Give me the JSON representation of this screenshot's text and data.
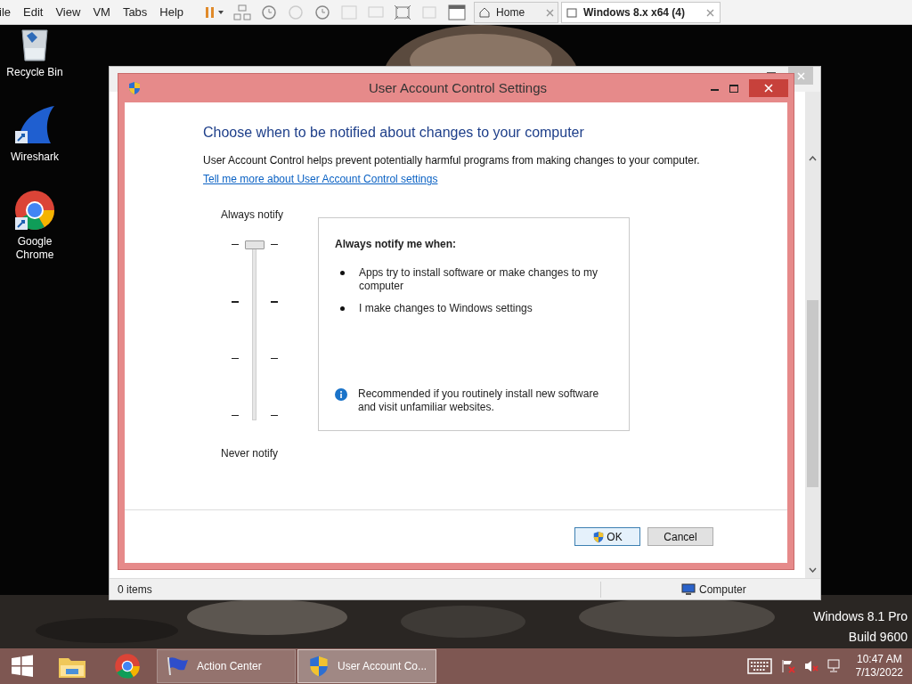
{
  "vm_menu": [
    "ile",
    "Edit",
    "View",
    "VM",
    "Tabs",
    "Help"
  ],
  "vm_tabs": [
    {
      "label": "Home",
      "selected": false
    },
    {
      "label": "Windows 8.x x64 (4)",
      "selected": true
    }
  ],
  "desktop_icons": [
    {
      "label": "Recycle Bin",
      "kind": "recycle"
    },
    {
      "label": "Wireshark",
      "kind": "wireshark"
    },
    {
      "label": "Google Chrome",
      "kind": "chrome"
    }
  ],
  "explorer": {
    "status": "0 items",
    "location": "Computer"
  },
  "dialog": {
    "title": "User Account Control Settings",
    "heading": "Choose when to be notified about changes to your computer",
    "description": "User Account Control helps prevent potentially harmful programs from making changes to your computer.",
    "link": "Tell me more about User Account Control settings",
    "slider": {
      "top_label": "Always notify",
      "bottom_label": "Never notify",
      "level": 1
    },
    "panel": {
      "title": "Always notify me when:",
      "bullets": [
        "Apps try to install software or make changes to my computer",
        "I make changes to Windows settings"
      ],
      "note": "Recommended if you routinely install new software and visit unfamiliar websites."
    },
    "buttons": [
      {
        "label": "OK",
        "kind": "shield"
      },
      {
        "label": "Cancel",
        "kind": "plain"
      }
    ]
  },
  "desktop_text": [
    "Windows 8.1 Pro",
    "Build 9600"
  ],
  "taskbar": {
    "buttons": [
      {
        "label": "Action Center",
        "kind": "flag",
        "selected": false
      },
      {
        "label": "User Account Co...",
        "kind": "shield",
        "selected": true
      }
    ],
    "time": "10:47 AM",
    "date": "7/13/2022"
  }
}
